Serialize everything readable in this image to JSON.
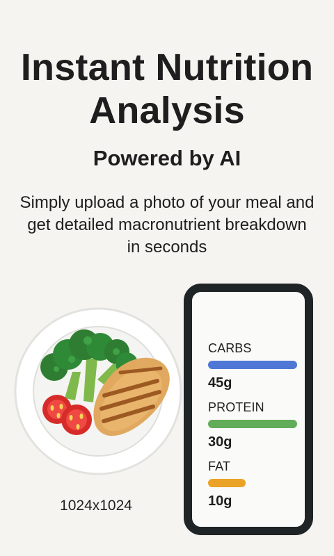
{
  "hero": {
    "title": "Instant Nutrition Analysis",
    "subtitle": "Powered by AI",
    "description": "Simply upload a photo of your meal and get detailed macronutrient breakdown in seconds"
  },
  "image_size_label": "1024x1024",
  "macros": [
    {
      "label": "CARBS",
      "value": "45g",
      "color": "#4f78d6",
      "fill": 1.0
    },
    {
      "label": "PROTEIN",
      "value": "30g",
      "color": "#61ad59",
      "fill": 1.0
    },
    {
      "label": "FAT",
      "value": "10g",
      "color": "#eaa326",
      "fill": 0.42
    }
  ],
  "illustration": {
    "plate": "meal-plate-illustration",
    "foods": [
      "broccoli-icon",
      "tomato-slice-icon",
      "grilled-chicken-icon"
    ]
  }
}
